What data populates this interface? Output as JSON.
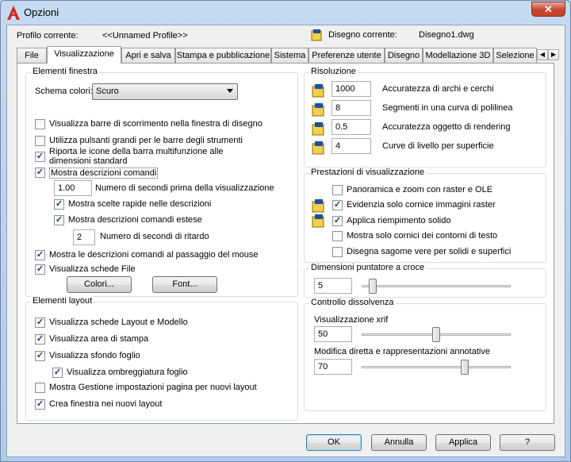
{
  "window": {
    "title": "Opzioni",
    "close_glyph": "✕"
  },
  "header": {
    "profile_label": "Profilo corrente:",
    "profile_value": "<<Unnamed Profile>>",
    "drawing_label": "Disegno corrente:",
    "drawing_value": "Disegno1.dwg"
  },
  "tabs": [
    {
      "label": "File"
    },
    {
      "label": "Visualizzazione"
    },
    {
      "label": "Apri e salva"
    },
    {
      "label": "Stampa e pubblicazione"
    },
    {
      "label": "Sistema"
    },
    {
      "label": "Preferenze utente"
    },
    {
      "label": "Disegno"
    },
    {
      "label": "Modellazione 3D"
    },
    {
      "label": "Selezione"
    }
  ],
  "tab_scroll": {
    "left": "◀",
    "right": "▶"
  },
  "window_elements": {
    "title": "Elementi finestra",
    "scheme_label": "Schema colori:",
    "scheme_value": "Scuro",
    "items": [
      {
        "label": "Visualizza barre di scorrimento nella finestra di disegno",
        "checked": false
      },
      {
        "label": "Utilizza pulsanti grandi per le barre degli strumenti",
        "checked": false
      },
      {
        "label": "Riporta le icone della barra multifunzione alle",
        "label2": "dimensioni standard",
        "checked": true
      },
      {
        "label": "Mostra descrizioni comandi",
        "checked": true
      },
      {
        "label": "Mostra scelte rapide nelle descrizioni",
        "checked": true
      },
      {
        "label": "Mostra descrizioni comandi estese",
        "checked": true
      },
      {
        "label": "Mostra le descrizioni comandi al passaggio del mouse",
        "checked": true
      },
      {
        "label": "Visualizza schede File",
        "checked": true
      }
    ],
    "delay_value": "1.00",
    "delay_label": "Numero di secondi prima della visualizzazione",
    "ext_delay_value": "2",
    "ext_delay_label": "Numero di secondi di ritardo",
    "colors_button": "Colori...",
    "font_button": "Font..."
  },
  "layout_elements": {
    "title": "Elementi layout",
    "items": [
      {
        "label": "Visualizza schede Layout e Modello",
        "checked": true
      },
      {
        "label": "Visualizza area di stampa",
        "checked": true
      },
      {
        "label": "Visualizza sfondo foglio",
        "checked": true
      },
      {
        "label": "Visualizza ombreggiatura foglio",
        "checked": true
      },
      {
        "label": "Mostra Gestione impostazioni pagina per nuovi layout",
        "checked": false
      },
      {
        "label": "Crea finestra nei nuovi layout",
        "checked": true
      }
    ]
  },
  "resolution": {
    "title": "Risoluzione",
    "items": [
      {
        "value": "1000",
        "label": "Accuratezza di archi e cerchi"
      },
      {
        "value": "8",
        "label": "Segmenti in una curva di polilinea"
      },
      {
        "value": "0.5",
        "label": "Accuratezza oggetto di rendering"
      },
      {
        "value": "4",
        "label": "Curve di livello per superficie"
      }
    ]
  },
  "performance": {
    "title": "Prestazioni di visualizzazione",
    "items": [
      {
        "label": "Panoramica e zoom con raster e OLE",
        "checked": false
      },
      {
        "label": "Evidenzia solo cornice immagini raster",
        "checked": true
      },
      {
        "label": "Applica riempimento solido",
        "checked": true
      },
      {
        "label": "Mostra solo cornici dei contorni di testo",
        "checked": false
      },
      {
        "label": "Disegna sagome vere per solidi e superfici",
        "checked": false
      }
    ]
  },
  "crosshair": {
    "title": "Dimensioni puntatore a croce",
    "value": "5",
    "level_pct": 5
  },
  "fade": {
    "title": "Controllo dissolvenza",
    "xref_label": "Visualizzazione xrif",
    "xref_value": "50",
    "xref_level_pct": 50,
    "inplace_label": "Modifica diretta e rappresentazioni annotative",
    "inplace_value": "70",
    "inplace_level_pct": 70
  },
  "footer": {
    "ok": "OK",
    "cancel": "Annulla",
    "apply": "Applica",
    "help": "?"
  },
  "check_glyph": "✓",
  "colors": {
    "title_close": "#c7442c",
    "app_icon": "#d32a1f",
    "window_frame": "#aecbe9"
  }
}
